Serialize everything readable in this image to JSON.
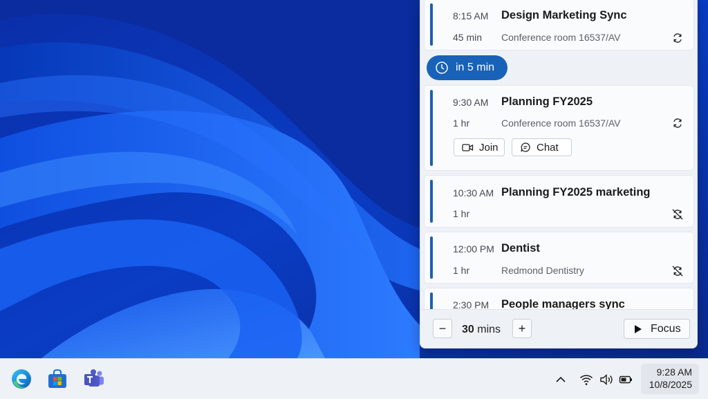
{
  "calendar": {
    "upcoming_badge": "in 5 min",
    "events": [
      {
        "time": "8:15 AM",
        "title": "Design Marketing Sync",
        "duration": "45 min",
        "location": "Conference room 16537/AV",
        "status_icon": "recurring-icon"
      },
      {
        "time": "9:30 AM",
        "title": "Planning FY2025",
        "duration": "1 hr",
        "location": "Conference room 16537/AV",
        "status_icon": "recurring-icon",
        "join_label": "Join",
        "chat_label": "Chat"
      },
      {
        "time": "10:30 AM",
        "title": "Planning FY2025 marketing",
        "duration": "1 hr",
        "location": "",
        "status_icon": "recurrence-off-icon"
      },
      {
        "time": "12:00 PM",
        "title": "Dentist",
        "duration": "1 hr",
        "location": "Redmond Dentistry",
        "status_icon": "recurrence-off-icon"
      },
      {
        "time": "2:30 PM",
        "title": "People managers sync"
      }
    ],
    "focus": {
      "minus_label": "−",
      "value": "30",
      "unit": "mins",
      "plus_label": "+",
      "button_label": "Focus"
    }
  },
  "taskbar": {
    "apps": [
      "edge-icon",
      "store-icon",
      "teams-icon"
    ],
    "tray_icons": [
      "chevron-up-icon",
      "wifi-icon",
      "volume-icon",
      "battery-icon"
    ],
    "time": "9:28 AM",
    "date": "10/8/2025"
  },
  "colors": {
    "accent": "#1862b8",
    "event_bar": "#1c5fb4"
  }
}
